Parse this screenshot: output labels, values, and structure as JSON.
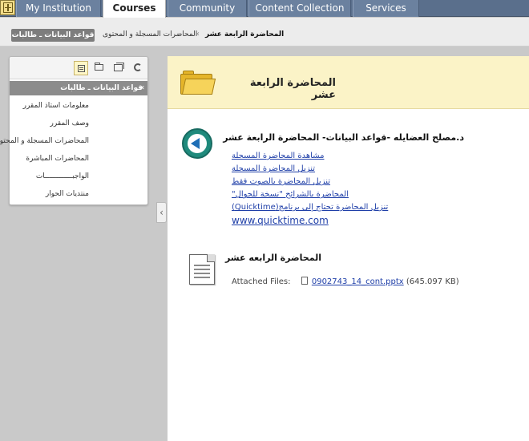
{
  "top_tabs": [
    {
      "label": "My Institution",
      "active": false
    },
    {
      "label": "Courses",
      "active": true
    },
    {
      "label": "Community",
      "active": false
    },
    {
      "label": "Content Collection",
      "active": false
    },
    {
      "label": "Services",
      "active": false
    }
  ],
  "breadcrumb": {
    "course_button": "قواعد البيانات ـ طالبات",
    "items": [
      "المحاضرات المسجلة و المحتوى",
      "المحاضرة الرابعة عشر"
    ],
    "separator": "‹"
  },
  "left_panel": {
    "header": "قواعد البيانات ـ طالبات",
    "items": [
      "معلومات استاذ المقرر",
      "وصف المقرر",
      "المحاضرات المسجلة و المحتوى",
      "المحاضرات المباشرة",
      "الواجبـــــــــــــات",
      "منتديات الحوار"
    ]
  },
  "main": {
    "title": "المحاضرة الرابعة عشر",
    "item1": {
      "title": "د.مصلح العضايله -قواعد البيانات- المحاضرة الرابعة عشر",
      "links": [
        "مشاهدة المحاضرة المسجلة",
        "تنزيل المحاضرة المسجلة",
        "تنزيل المحاضرة بالصوت فقط",
        "المحاضرة بالشرائح \"نسخة للجوال\"",
        "تنزيل المحاضرة تحتاج إلى برنامج(Quicktime)",
        "www.quicktime.com"
      ]
    },
    "item2": {
      "title": "المحاضرة الرابعه عشر",
      "attached_label": "Attached Files:",
      "file_name": "0902743_14_cont.pptx",
      "file_size": "(645.097 KB)"
    }
  },
  "colors": {
    "tabbar": "#5a6f8c",
    "header_bg": "#fbf3c7",
    "link": "#1f3fa8",
    "panel_header": "#8c8c8c"
  }
}
